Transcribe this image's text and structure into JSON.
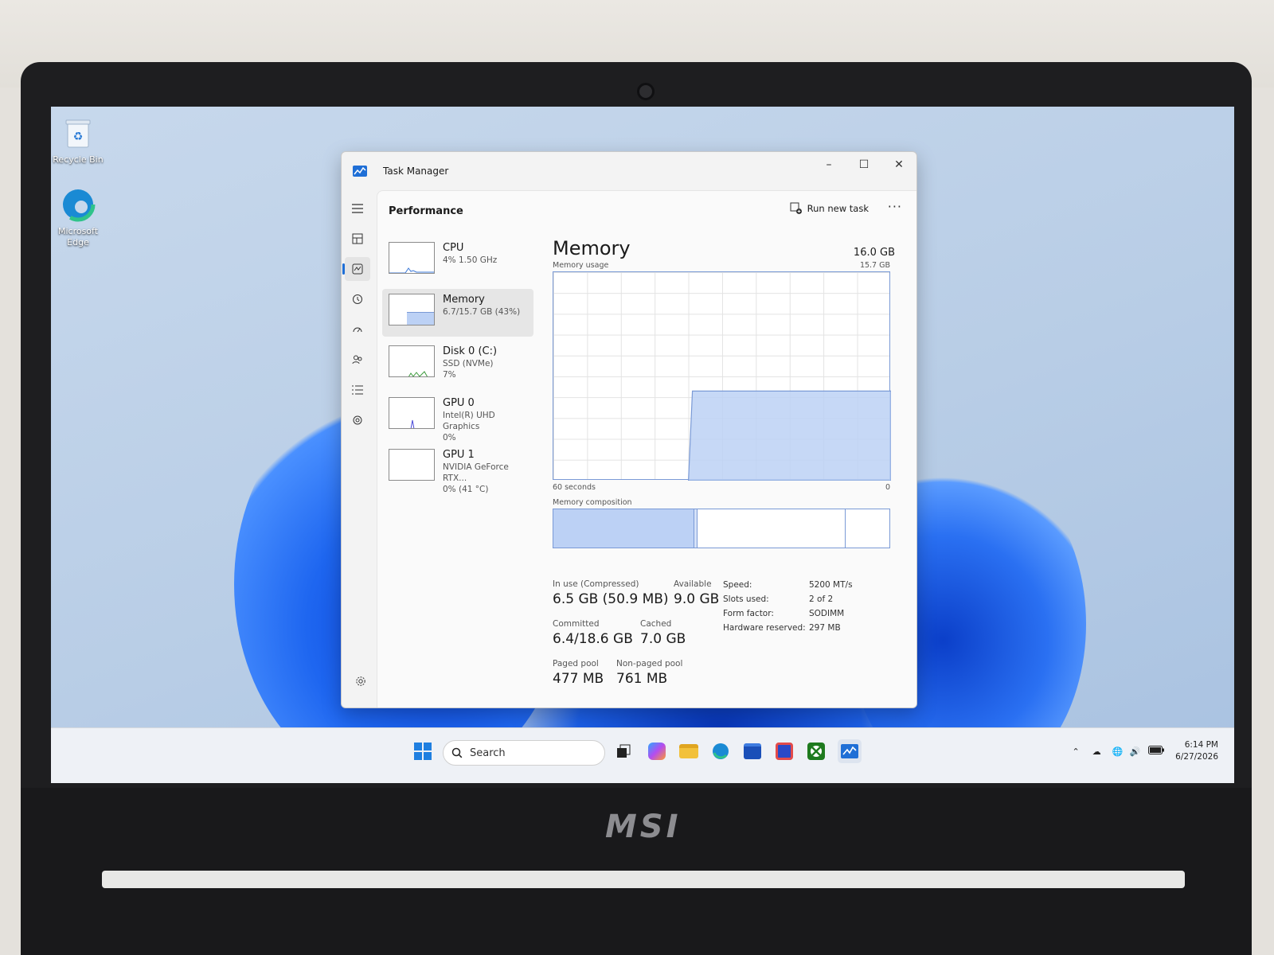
{
  "desktop": {
    "icons": [
      {
        "label": "Recycle Bin"
      },
      {
        "label": "Microsoft Edge"
      }
    ]
  },
  "window": {
    "title": "Task Manager",
    "controls": {
      "minimize": "–",
      "maximize": "☐",
      "close": "✕"
    }
  },
  "header": {
    "page_title": "Performance",
    "run_task_label": "Run new task",
    "more_label": "···"
  },
  "devices": [
    {
      "name": "CPU",
      "sub1": "4%  1.50 GHz",
      "sub2": ""
    },
    {
      "name": "Memory",
      "sub1": "6.7/15.7 GB (43%)",
      "sub2": ""
    },
    {
      "name": "Disk 0 (C:)",
      "sub1": "SSD (NVMe)",
      "sub2": "7%"
    },
    {
      "name": "GPU 0",
      "sub1": "Intel(R) UHD Graphics",
      "sub2": "0%"
    },
    {
      "name": "GPU 1",
      "sub1": "NVIDIA GeForce RTX...",
      "sub2": "0%  (41 °C)"
    }
  ],
  "memory": {
    "heading": "Memory",
    "total": "16.0 GB",
    "usage_label": "Memory usage",
    "usage_max": "15.7 GB",
    "x_left": "60 seconds",
    "x_right": "0",
    "composition_label": "Memory composition",
    "usage_fraction": 0.43,
    "composition": {
      "in_use": 0.42,
      "modified": 0.01,
      "standby": 0.44,
      "free": 0.13
    },
    "stats": {
      "in_use_k": "In use (Compressed)",
      "in_use_v": "6.5 GB (50.9 MB)",
      "available_k": "Available",
      "available_v": "9.0 GB",
      "committed_k": "Committed",
      "committed_v": "6.4/18.6 GB",
      "cached_k": "Cached",
      "cached_v": "7.0 GB",
      "paged_k": "Paged pool",
      "paged_v": "477 MB",
      "nonpaged_k": "Non-paged pool",
      "nonpaged_v": "761 MB"
    },
    "specs": {
      "speed_k": "Speed:",
      "speed_v": "5200 MT/s",
      "slots_k": "Slots used:",
      "slots_v": "2 of 2",
      "form_k": "Form factor:",
      "form_v": "SODIMM",
      "hwres_k": "Hardware reserved:",
      "hwres_v": "297 MB"
    }
  },
  "taskbar": {
    "search_placeholder": "Search",
    "time": "6:14 PM",
    "date": "6/27/2026"
  },
  "device_brand": "MSI",
  "colors": {
    "accent": "#1f6fd6",
    "mem_fill": "#bcd1f5",
    "mem_line": "#7a9ad6"
  }
}
